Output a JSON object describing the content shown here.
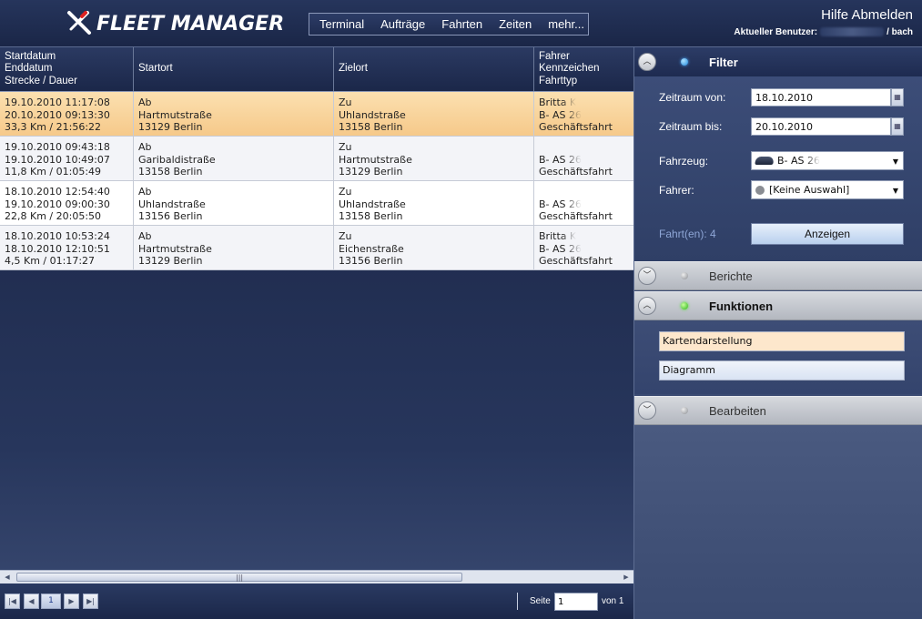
{
  "header": {
    "logo_text": "FLEET MANAGER",
    "nav": [
      "Terminal",
      "Aufträge",
      "Fahrten",
      "Zeiten",
      "mehr..."
    ],
    "links": [
      "Hilfe",
      "Abmelden"
    ],
    "user_label": "Aktueller Benutzer:",
    "user_suffix": "/ bach"
  },
  "table": {
    "columns": [
      [
        "Startdatum",
        "Enddatum",
        "Strecke / Dauer"
      ],
      [
        "Startort"
      ],
      [
        "Zielort"
      ],
      [
        "Fahrer",
        "Kennzeichen",
        "Fahrttyp"
      ]
    ],
    "rows": [
      {
        "selected": true,
        "c1": [
          "19.10.2010 11:17:08",
          "20.10.2010 09:13:30",
          "33,3 Km / 21:56:22"
        ],
        "c2": [
          "Ab",
          "Hartmutstraße",
          "13129 Berlin"
        ],
        "c3": [
          "Zu",
          "Uhlandstraße",
          "13158 Berlin"
        ],
        "c4": [
          "Britta K",
          "B- AS 26",
          "Geschäftsfahrt"
        ]
      },
      {
        "selected": false,
        "c1": [
          "19.10.2010 09:43:18",
          "19.10.2010 10:49:07",
          "11,8 Km / 01:05:49"
        ],
        "c2": [
          "Ab",
          "Garibaldistraße",
          "13158 Berlin"
        ],
        "c3": [
          "Zu",
          "Hartmutstraße",
          "13129 Berlin"
        ],
        "c4": [
          "",
          "B- AS 26",
          "Geschäftsfahrt"
        ]
      },
      {
        "selected": false,
        "c1": [
          "18.10.2010 12:54:40",
          "19.10.2010 09:00:30",
          "22,8 Km / 20:05:50"
        ],
        "c2": [
          "Ab",
          "Uhlandstraße",
          "13156 Berlin"
        ],
        "c3": [
          "Zu",
          "Uhlandstraße",
          "13158 Berlin"
        ],
        "c4": [
          "",
          "B- AS 26",
          "Geschäftsfahrt"
        ]
      },
      {
        "selected": false,
        "c1": [
          "18.10.2010 10:53:24",
          "18.10.2010 12:10:51",
          "4,5 Km / 01:17:27"
        ],
        "c2": [
          "Ab",
          "Hartmutstraße",
          "13129 Berlin"
        ],
        "c3": [
          "Zu",
          "Eichenstraße",
          "13156 Berlin"
        ],
        "c4": [
          "Britta K",
          "B- AS 26",
          "Geschäftsfahrt"
        ]
      }
    ]
  },
  "pager": {
    "first_icon": "first-page-icon",
    "prev_icon": "prev-page-icon",
    "current_page": "1",
    "next_icon": "next-page-icon",
    "last_icon": "last-page-icon",
    "seite_label": "Seite",
    "seite_value": "1",
    "von_label": "von 1"
  },
  "filter": {
    "title": "Filter",
    "zeitraum_von_label": "Zeitraum von:",
    "zeitraum_von_value": "18.10.2010",
    "zeitraum_bis_label": "Zeitraum bis:",
    "zeitraum_bis_value": "20.10.2010",
    "fahrzeug_label": "Fahrzeug:",
    "fahrzeug_value": "B- AS 26",
    "fahrer_label": "Fahrer:",
    "fahrer_value": "[Keine Auswahl]",
    "count_text": "Fahrt(en): 4",
    "anzeigen_label": "Anzeigen"
  },
  "sections": {
    "berichte": "Berichte",
    "funktionen": "Funktionen",
    "bearbeiten": "Bearbeiten"
  },
  "funktionen": {
    "kartendarstellung": "Kartendarstellung",
    "diagramm": "Diagramm"
  },
  "colors": {
    "header_bg": "#1a2647",
    "selected_row": "#f6c98a",
    "status_active_filter": "#1f8ae0",
    "status_active_funktionen": "#2bb517"
  }
}
